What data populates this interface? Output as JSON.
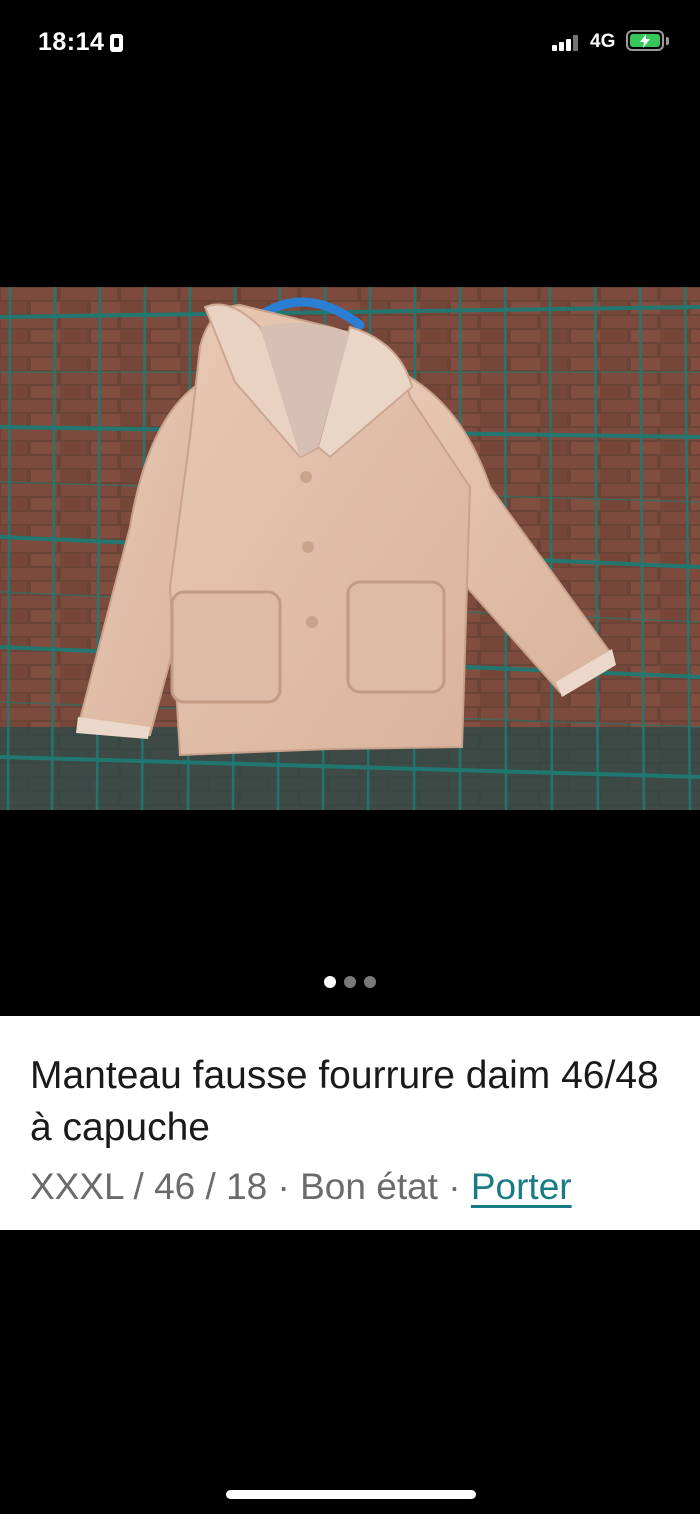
{
  "status_bar": {
    "time": "18:14",
    "network": "4G",
    "battery_color": "#35c759"
  },
  "photo": {
    "alt": "Manteau fausse fourrure daim 46/48 à capuche",
    "image_count": 3,
    "active_index": 0
  },
  "listing": {
    "title": "Manteau fausse fourrure daim 46/48 à capuche",
    "size": "XXXL / 46 / 18",
    "separator": "·",
    "condition": "Bon état",
    "brand": "Porter",
    "brand_color": "#197b83"
  }
}
